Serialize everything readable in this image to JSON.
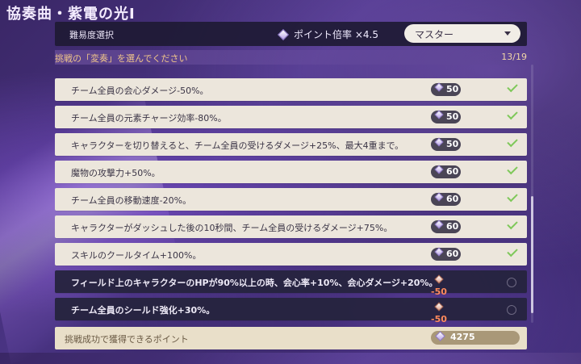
{
  "title": "協奏曲・紫電の光Ⅰ",
  "difficulty": {
    "label": "難易度選択",
    "multiplier": "ポイント倍率 ×4.5",
    "selected": "マスター"
  },
  "hint": {
    "text": "挑戦の「変奏」を選んでください",
    "count": "13/19"
  },
  "variations": [
    {
      "label": "チーム全員の会心ダメージ-50%。",
      "points": "50",
      "selected": true
    },
    {
      "label": "チーム全員の元素チャージ効率-80%。",
      "points": "50",
      "selected": true
    },
    {
      "label": "キャラクターを切り替えると、チーム全員の受けるダメージ+25%、最大4重まで。",
      "points": "50",
      "selected": true
    },
    {
      "label": "魔物の攻撃力+50%。",
      "points": "60",
      "selected": true
    },
    {
      "label": "チーム全員の移動速度-20%。",
      "points": "60",
      "selected": true
    },
    {
      "label": "キャラクターがダッシュした後の10秒間、チーム全員の受けるダメージ+75%。",
      "points": "60",
      "selected": true
    },
    {
      "label": "スキルのクールタイム+100%。",
      "points": "60",
      "selected": true
    },
    {
      "label": "フィールド上のキャラクターのHPが90%以上の時、会心率+10%、会心ダメージ+20%。",
      "points": "-50",
      "selected": false
    },
    {
      "label": "チーム全員のシールド強化+30%。",
      "points": "-50",
      "selected": false
    }
  ],
  "footer": {
    "label": "挑戦成功で獲得できるポイント",
    "points": "4275"
  },
  "colors": {
    "accent_check": "#7fc85a",
    "negative": "#ff8a5c",
    "hint": "#f1c68a"
  }
}
